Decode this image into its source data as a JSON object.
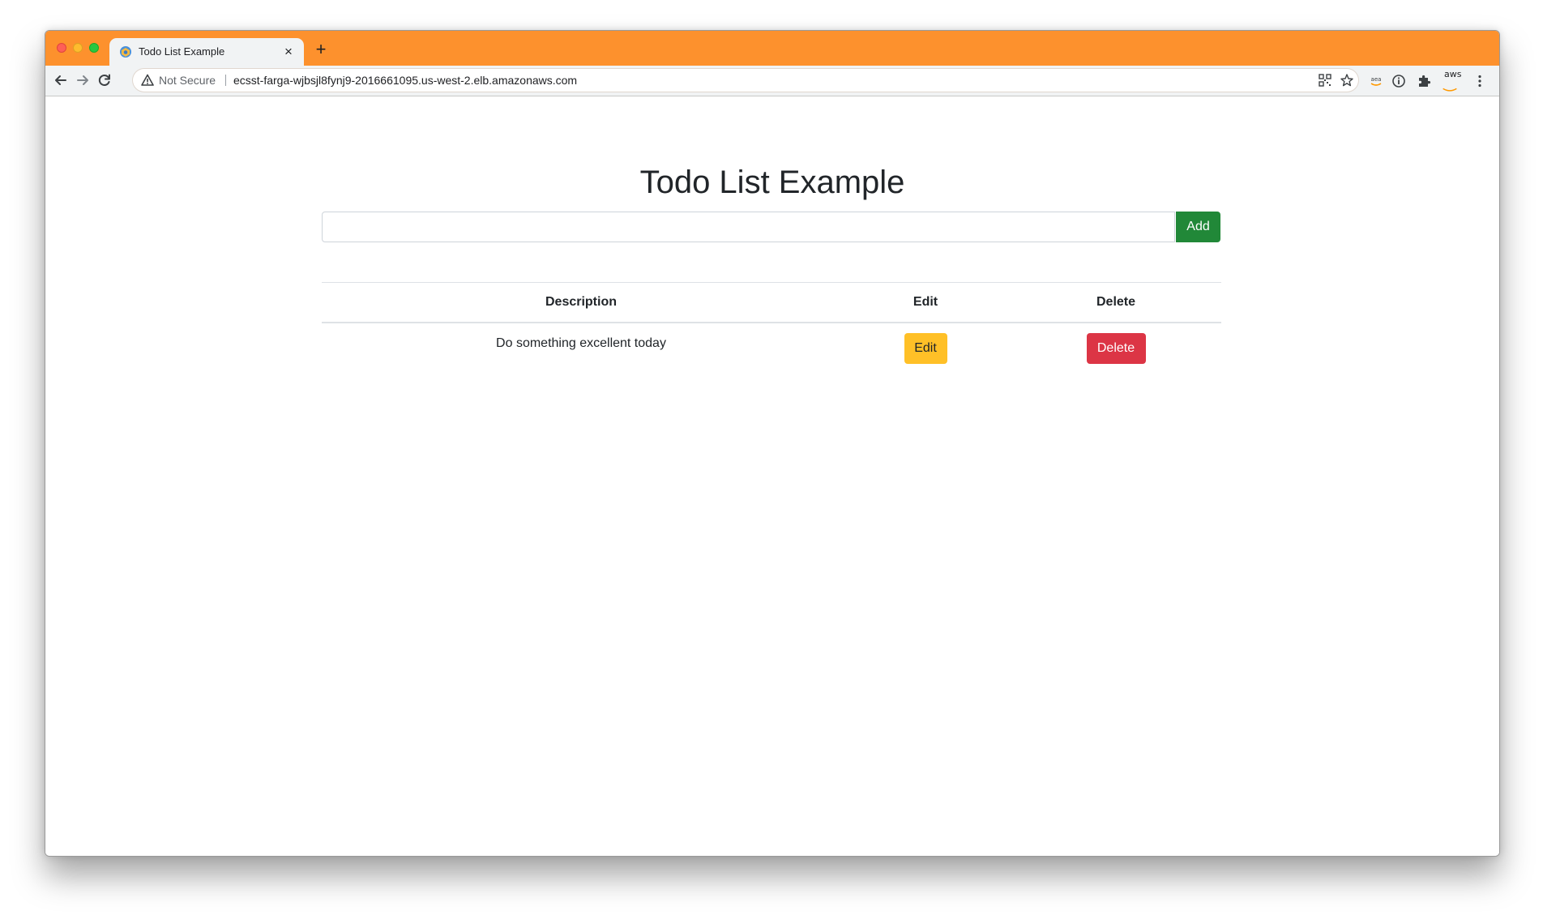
{
  "browser": {
    "tab_title": "Todo List Example",
    "tab_close": "×",
    "new_tab": "+",
    "security_label": "Not Secure",
    "url": "ecsst-farga-wjbsjl8fynj9-2016661095.us-west-2.elb.amazonaws.com",
    "aws_extension_label": "aws",
    "accent_color": "#fd912d",
    "icons": [
      "back-arrow-icon",
      "forward-arrow-icon",
      "reload-icon",
      "warning-icon",
      "qr-code-icon",
      "star-icon",
      "extension-icon",
      "info-icon",
      "puzzle-icon",
      "aws-icon",
      "menu-dots-icon"
    ]
  },
  "page": {
    "title": "Todo List Example",
    "input": {
      "value": "",
      "placeholder": ""
    },
    "add_label": "Add",
    "table": {
      "headers": [
        "Description",
        "Edit",
        "Delete"
      ],
      "rows": [
        {
          "description": "Do something excellent today",
          "edit_label": "Edit",
          "delete_label": "Delete"
        }
      ]
    },
    "colors": {
      "add": "#218838",
      "edit": "#ffc027",
      "delete": "#dc3545"
    }
  }
}
